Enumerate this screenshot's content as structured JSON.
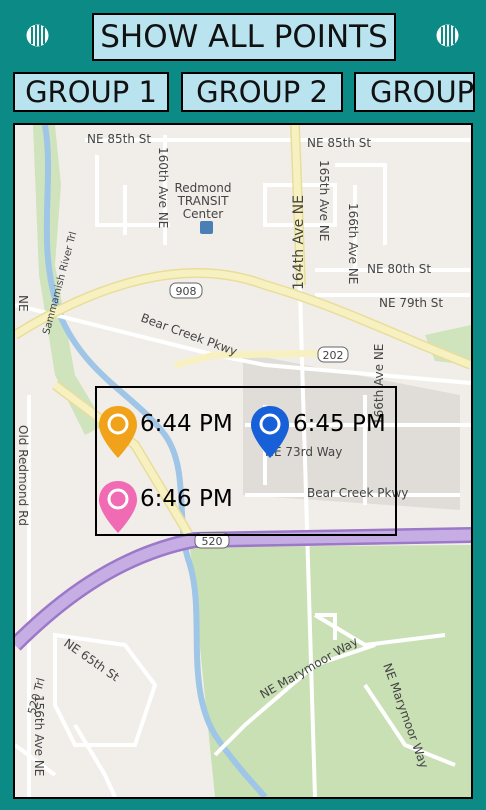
{
  "toolbar": {
    "show_all_label": "SHOW ALL POINTS",
    "left_icon": "menu-stripes-icon",
    "right_icon": "menu-stripes-icon"
  },
  "groups": [
    {
      "label": "GROUP 1"
    },
    {
      "label": "GROUP 2"
    },
    {
      "label": "GROUP"
    }
  ],
  "map": {
    "streets": {
      "ne85": "NE 85th St",
      "ne85b": "NE 85th St",
      "ave160": "160th Ave NE",
      "transit1": "Redmond",
      "transit2": "TRANSIT",
      "transit3": "Center",
      "ave164": "164th Ave NE",
      "ave165": "165th Ave NE",
      "ave166a": "166th Ave NE",
      "ne80": "NE 80th St",
      "ne79": "NE 79th St",
      "route908": "908",
      "trail": "Sammamish River Trl",
      "bearcreek1": "Bear Creek Pkwy",
      "route202": "202",
      "ne_left": "NE",
      "oldredmond": "Old Redmond Rd",
      "ne73": "NE 73rd Way",
      "ave166b": "166th Ave NE",
      "bearcreek2": "Bear Creek Pkwy",
      "route520": "520",
      "trail520": "520 Trl",
      "ne65": "NE 65th St",
      "ave156": "156th Ave NE",
      "marymoor1": "NE Marymoor Way",
      "marymoor2": "NE Marymoor Way"
    },
    "points": [
      {
        "time": "6:44 PM",
        "color": "#f0a21a"
      },
      {
        "time": "6:45 PM",
        "color": "#1760d8"
      },
      {
        "time": "6:46 PM",
        "color": "#f06bb3"
      }
    ]
  },
  "colors": {
    "background": "#0b8a86",
    "button": "#b9e3ef",
    "highway": "#b89ad6",
    "major_road": "#f7f1c2",
    "river": "#9fc6e6",
    "park": "#c9dfb4"
  }
}
